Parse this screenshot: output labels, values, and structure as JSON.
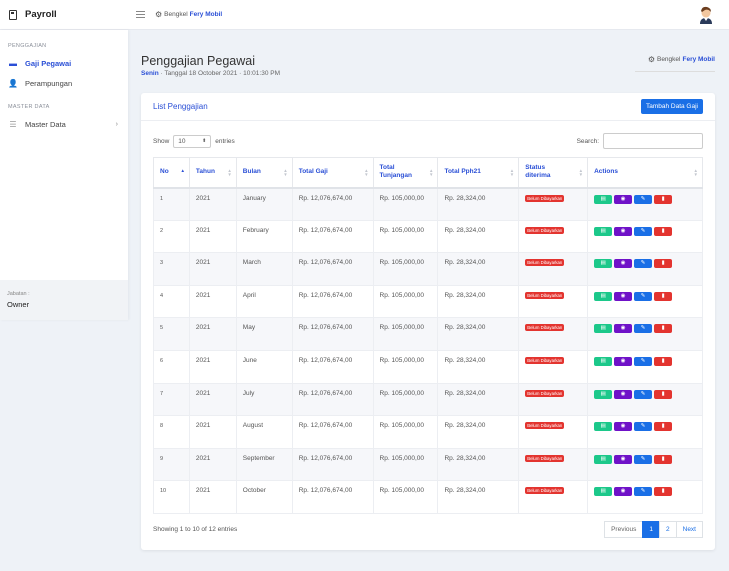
{
  "app": {
    "title": "Payroll",
    "shop_prefix": "Bengkel",
    "shop_name": "Fery Mobil"
  },
  "sidebar": {
    "sections": [
      {
        "title": "PENGGAJIAN",
        "items": [
          {
            "label": "Gaji Pegawai",
            "active": true
          },
          {
            "label": "Perampungan"
          }
        ]
      },
      {
        "title": "MASTER DATA",
        "items": [
          {
            "label": "Master Data"
          }
        ]
      }
    ],
    "jabatan_label": "Jabatan :",
    "jabatan_value": "Owner"
  },
  "page": {
    "title": "Penggajian Pegawai",
    "day": "Senin",
    "datetime": " · Tanggal 18 October 2021 · 10:01:30 PM",
    "right_prefix": "Bengkel",
    "right_name": "Fery Mobil"
  },
  "card": {
    "title": "List Penggajian",
    "add_button": "Tambah Data Gaji",
    "show_label": "Show",
    "show_value": "10",
    "entries_label": "entries",
    "search_label": "Search:",
    "search_value": ""
  },
  "table": {
    "headers": {
      "no": "No",
      "tahun": "Tahun",
      "bulan": "Bulan",
      "gaji": "Total Gaji",
      "tunjangan": "Total Tunjangan",
      "pph": "Total Pph21",
      "status": "Status diterima",
      "actions": "Actions"
    },
    "rows": [
      {
        "no": "1",
        "tahun": "2021",
        "bulan": "January",
        "gaji": "Rp. 12,076,674,00",
        "tunjangan": "Rp. 105,000,00",
        "pph": "Rp. 28,324,00",
        "status": "Belum Dibayarkan"
      },
      {
        "no": "2",
        "tahun": "2021",
        "bulan": "February",
        "gaji": "Rp. 12,076,674,00",
        "tunjangan": "Rp. 105,000,00",
        "pph": "Rp. 28,324,00",
        "status": "Belum Dibayarkan"
      },
      {
        "no": "3",
        "tahun": "2021",
        "bulan": "March",
        "gaji": "Rp. 12,076,674,00",
        "tunjangan": "Rp. 105,000,00",
        "pph": "Rp. 28,324,00",
        "status": "Belum Dibayarkan"
      },
      {
        "no": "4",
        "tahun": "2021",
        "bulan": "April",
        "gaji": "Rp. 12,076,674,00",
        "tunjangan": "Rp. 105,000,00",
        "pph": "Rp. 28,324,00",
        "status": "Belum Dibayarkan"
      },
      {
        "no": "5",
        "tahun": "2021",
        "bulan": "May",
        "gaji": "Rp. 12,076,674,00",
        "tunjangan": "Rp. 105,000,00",
        "pph": "Rp. 28,324,00",
        "status": "Belum Dibayarkan"
      },
      {
        "no": "6",
        "tahun": "2021",
        "bulan": "June",
        "gaji": "Rp. 12,076,674,00",
        "tunjangan": "Rp. 105,000,00",
        "pph": "Rp. 28,324,00",
        "status": "Belum Dibayarkan"
      },
      {
        "no": "7",
        "tahun": "2021",
        "bulan": "July",
        "gaji": "Rp. 12,076,674,00",
        "tunjangan": "Rp. 105,000,00",
        "pph": "Rp. 28,324,00",
        "status": "Belum Dibayarkan"
      },
      {
        "no": "8",
        "tahun": "2021",
        "bulan": "August",
        "gaji": "Rp. 12,076,674,00",
        "tunjangan": "Rp. 105,000,00",
        "pph": "Rp. 28,324,00",
        "status": "Belum Dibayarkan"
      },
      {
        "no": "9",
        "tahun": "2021",
        "bulan": "September",
        "gaji": "Rp. 12,076,674,00",
        "tunjangan": "Rp. 105,000,00",
        "pph": "Rp. 28,324,00",
        "status": "Belum Dibayarkan"
      },
      {
        "no": "10",
        "tahun": "2021",
        "bulan": "October",
        "gaji": "Rp. 12,076,674,00",
        "tunjangan": "Rp. 105,000,00",
        "pph": "Rp. 28,324,00",
        "status": "Belum Dibayarkan"
      }
    ]
  },
  "footer": {
    "info": "Showing 1 to 10 of 12 entries",
    "pages": {
      "previous": "Previous",
      "p1": "1",
      "p2": "2",
      "next": "Next"
    }
  },
  "icons": {
    "brand": "calculator-icon",
    "menu": "hamburger-icon",
    "shop": "cogs-icon",
    "gaji": "money-bill-icon",
    "perampungan": "user-icon",
    "master": "database-icon",
    "actions": [
      "print-icon",
      "eye-icon",
      "edit-icon",
      "trash-icon"
    ]
  },
  "colors": {
    "primary": "#1a6fe6",
    "link": "#2a4fd6",
    "danger": "#e3342f",
    "success": "#1cc88a",
    "purple": "#6f12c8"
  }
}
